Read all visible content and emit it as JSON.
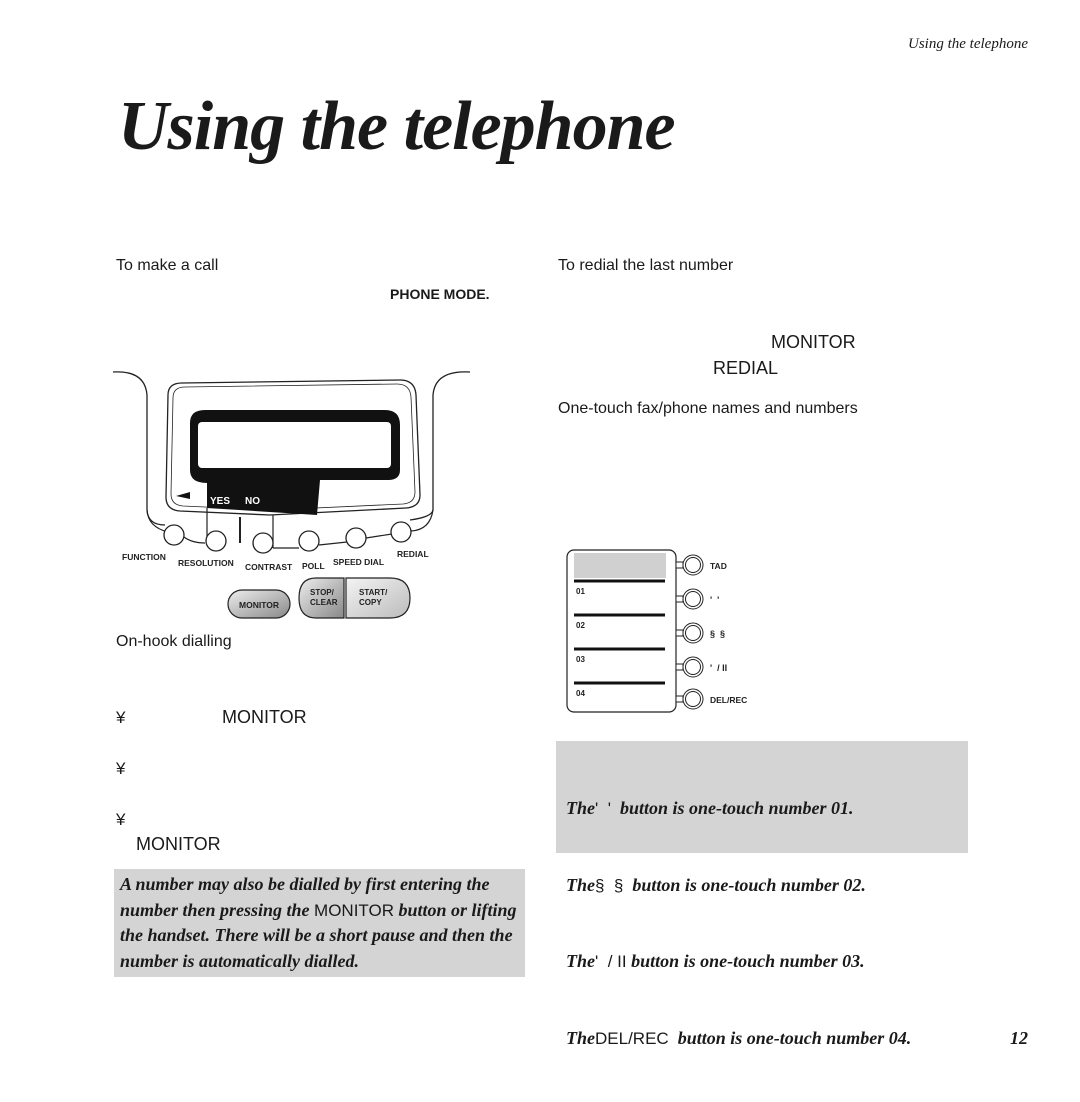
{
  "running_head": "Using the telephone",
  "title": "Using the telephone",
  "left_column": {
    "make_call_heading": "To make a call",
    "phone_mode_label": "PHONE MODE.",
    "on_hook_heading": "On-hook dialling",
    "bullets": [
      {
        "symbol": "¥",
        "keyword": "MONITOR"
      },
      {
        "symbol": "¥",
        "keyword": ""
      },
      {
        "symbol": "¥",
        "keyword": "MONITOR"
      }
    ],
    "note": {
      "part1": "A number may  also be dialled by first entering the number then pressing the ",
      "keyword": "MONITOR",
      "part2": " button or lifting the handset. There will be a short pause and then the number is automatically dialled."
    }
  },
  "right_column": {
    "redial_heading": "To redial the last number",
    "monitor_label": "MONITOR",
    "redial_label": "REDIAL",
    "one_touch_heading": "One-touch fax/phone names and numbers",
    "note_lines": [
      {
        "prefix": "The",
        "button": "'  '",
        "suffix": "  button is one-touch number 01."
      },
      {
        "prefix": "The",
        "button": "§  §",
        "suffix": "  button is one-touch number 02."
      },
      {
        "prefix": "The",
        "button": "'  / II",
        "suffix": " button is one-touch number 03."
      },
      {
        "prefix": "The",
        "button": "DEL/REC",
        "suffix": "  button is one-touch number 04."
      }
    ]
  },
  "control_panel_diagram": {
    "yes_label": "YES",
    "no_label": "NO",
    "buttons": [
      "FUNCTION",
      "RESOLUTION",
      "CONTRAST",
      "POLL",
      "SPEED DIAL",
      "REDIAL"
    ],
    "monitor_button": "MONITOR",
    "stop_clear": [
      "STOP/",
      "CLEAR"
    ],
    "start_copy": [
      "START/",
      "COPY"
    ]
  },
  "one_touch_diagram": {
    "slots": [
      "01",
      "02",
      "03",
      "04"
    ],
    "buttons": [
      "TAD",
      "'  '",
      "§  §",
      "'  / II",
      "DEL/REC"
    ]
  },
  "page_number": "12"
}
